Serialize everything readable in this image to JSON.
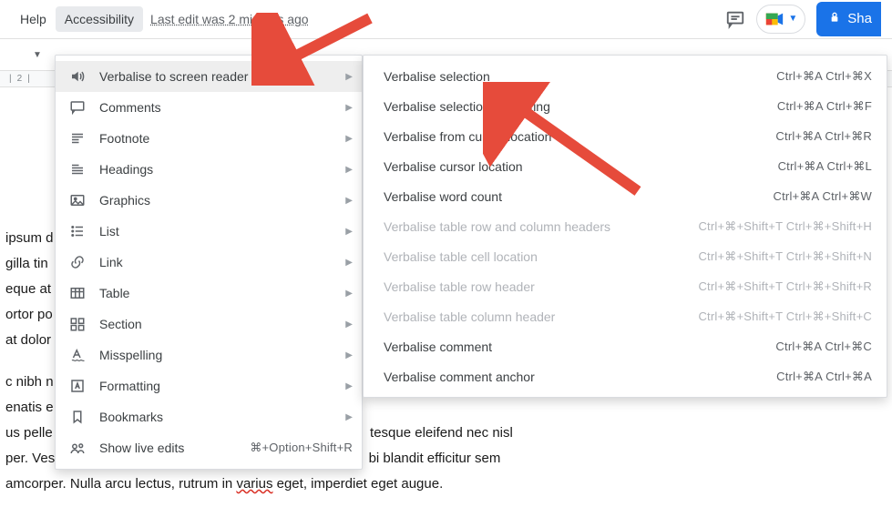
{
  "menubar": {
    "help": "Help",
    "accessibility": "Accessibility",
    "last_edit": "Last edit was 2 minutes ago"
  },
  "share": {
    "label": "Sha"
  },
  "ruler": {
    "mark": "2"
  },
  "menu1": {
    "items": [
      {
        "label": "Verbalise to screen reader",
        "icon": "volume-icon",
        "has_sub": true,
        "highlight": true
      },
      {
        "label": "Comments",
        "icon": "comment-icon",
        "has_sub": true
      },
      {
        "label": "Footnote",
        "icon": "footnote-icon",
        "has_sub": true
      },
      {
        "label": "Headings",
        "icon": "headings-icon",
        "has_sub": true
      },
      {
        "label": "Graphics",
        "icon": "image-icon",
        "has_sub": true
      },
      {
        "label": "List",
        "icon": "list-icon",
        "has_sub": true
      },
      {
        "label": "Link",
        "icon": "link-icon",
        "has_sub": true
      },
      {
        "label": "Table",
        "icon": "table-icon",
        "has_sub": true
      },
      {
        "label": "Section",
        "icon": "section-icon",
        "has_sub": true
      },
      {
        "label": "Misspelling",
        "icon": "misspelling-icon",
        "has_sub": true
      },
      {
        "label": "Formatting",
        "icon": "formatting-icon",
        "has_sub": true
      },
      {
        "label": "Bookmarks",
        "icon": "bookmark-icon",
        "has_sub": true
      },
      {
        "label": "Show live edits",
        "icon": "live-edits-icon",
        "has_sub": false,
        "shortcut": "⌘+Option+Shift+R"
      }
    ]
  },
  "menu2": {
    "items": [
      {
        "label": "Verbalise selection",
        "shortcut": "Ctrl+⌘A Ctrl+⌘X"
      },
      {
        "label": "Verbalise selection formatting",
        "shortcut": "Ctrl+⌘A Ctrl+⌘F"
      },
      {
        "label": "Verbalise from cursor location",
        "shortcut": "Ctrl+⌘A Ctrl+⌘R"
      },
      {
        "label": "Verbalise cursor location",
        "shortcut": "Ctrl+⌘A Ctrl+⌘L"
      },
      {
        "label": "Verbalise word count",
        "shortcut": "Ctrl+⌘A Ctrl+⌘W"
      },
      {
        "label": "Verbalise table row and column headers",
        "shortcut": "Ctrl+⌘+Shift+T Ctrl+⌘+Shift+H",
        "disabled": true
      },
      {
        "label": "Verbalise table cell location",
        "shortcut": "Ctrl+⌘+Shift+T Ctrl+⌘+Shift+N",
        "disabled": true
      },
      {
        "label": "Verbalise table row header",
        "shortcut": "Ctrl+⌘+Shift+T Ctrl+⌘+Shift+R",
        "disabled": true
      },
      {
        "label": "Verbalise table column header",
        "shortcut": "Ctrl+⌘+Shift+T Ctrl+⌘+Shift+C",
        "disabled": true
      },
      {
        "label": "Verbalise comment",
        "shortcut": "Ctrl+⌘A Ctrl+⌘C"
      },
      {
        "label": "Verbalise comment anchor",
        "shortcut": "Ctrl+⌘A Ctrl+⌘A"
      }
    ]
  },
  "doc": {
    "lines": [
      "ipsum d",
      "gilla tin",
      "eque at",
      "ortor po",
      "at dolor",
      "",
      "c nibh n",
      "enatis e",
      "us pelle",
      "per. Ves",
      "amcorper. Nulla arcu lectus, rutrum in"
    ],
    "tail_lines": [
      "tesque eleifend nec nisl",
      "bi blandit efficitur sem",
      "eget, imperdiet eget augue."
    ],
    "squiggle_word": "varius"
  }
}
